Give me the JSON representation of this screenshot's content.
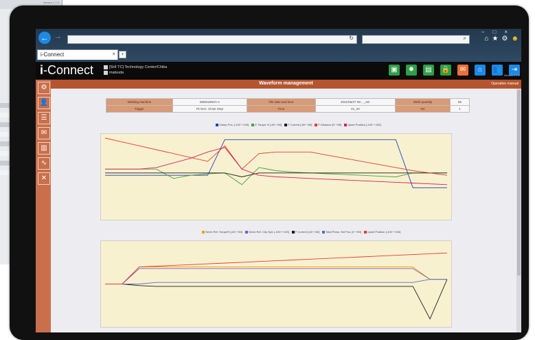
{
  "background_window": {
    "version_text": "Version 1.7.0",
    "stripe_colors": [
      "#c9cdd2",
      "#f2f3f5",
      "#c9cdd2",
      "#f2f3f5",
      "#c9cdd2",
      "#f2f3f5",
      "#c9cdd2",
      "#f2f3f5"
    ]
  },
  "browser": {
    "tab_title": "i-Connect",
    "address_value": "",
    "refresh_glyph": "↻",
    "search_glyph": "⌕",
    "window_controls": [
      "–",
      "□",
      "×"
    ],
    "nav_icons": [
      "home-icon",
      "star-icon",
      "gear-icon",
      "smiley-icon"
    ]
  },
  "app": {
    "logo_prefix": "i",
    "logo_rest": "-Connect",
    "site_name": "[SHI TC] Technology Center/Chiba",
    "user_name": "matsuda",
    "version": "Version 1.7.0",
    "header_icons": [
      {
        "name": "monitor-icon",
        "color": "#2f9e44"
      },
      {
        "name": "gear-settings-icon",
        "color": "#2f9e44"
      },
      {
        "name": "document-icon",
        "color": "#2f9e44"
      },
      {
        "name": "lock-icon",
        "color": "#2f9e44"
      },
      {
        "name": "chat-icon",
        "color": "#e8703a"
      },
      {
        "name": "home-icon",
        "color": "#1e88e5"
      },
      {
        "name": "users-icon",
        "color": "#1e88e5"
      },
      {
        "name": "logout-icon",
        "color": "#1e88e5"
      }
    ],
    "side_menu": [
      {
        "name": "welder-icon",
        "glyph": "⚙"
      },
      {
        "name": "people-icon",
        "glyph": "👤"
      },
      {
        "name": "list-icon",
        "glyph": "☰"
      },
      {
        "name": "mail-icon",
        "glyph": "✉"
      },
      {
        "name": "bar-chart-icon",
        "glyph": "▥"
      },
      {
        "name": "waveform-icon",
        "glyph": "∿"
      },
      {
        "name": "tools-icon",
        "glyph": "✕"
      }
    ]
  },
  "page": {
    "title": "Waveform management",
    "manual_link": "Operation manual",
    "info": {
      "welding_machine_label": "Welding machine",
      "welding_machine_value": "DB0015N0Y-A",
      "file_date_label": "File date and time",
      "file_date_value": "2021/06/27 05:..._NC",
      "weld_qty_label": "Weld quantity",
      "weld_qty_value": "65",
      "trigger_label": "Trigger",
      "trigger_value": "Fit Gen. Close Stop",
      "time_label": "Time",
      "time_value": "01_20",
      "ver_label": "Ver",
      "ver_value": "1"
    }
  },
  "chart_data": [
    {
      "type": "line",
      "title": "",
      "legend_placement": "top-center",
      "legend": [
        {
          "label": "Clamp Pos. [-100~+100]",
          "color": "#1c3fbf"
        },
        {
          "label": "E Torque % [-60~+60]",
          "color": "#43a047"
        },
        {
          "label": "F Current [-60~+60]",
          "color": "#1b1b1b"
        },
        {
          "label": "F Distance [0~+50]",
          "color": "#e53935"
        },
        {
          "label": "Upset Position [-100~+100]",
          "color": "#d81b60"
        }
      ],
      "x": [
        0,
        5,
        10,
        15,
        20,
        25,
        30,
        35,
        40,
        45,
        50,
        55,
        60,
        65,
        70,
        75,
        80,
        85,
        90,
        95,
        100
      ],
      "ylim": [
        0,
        100
      ],
      "grid": false,
      "series": [
        {
          "name": "Clamp Pos. [-100~+100]",
          "color": "#1c3fbf",
          "values": [
            52,
            52,
            52,
            52,
            52,
            52,
            52,
            98,
            98,
            98,
            98,
            98,
            98,
            98,
            98,
            98,
            98,
            98,
            36,
            36,
            36
          ]
        },
        {
          "name": "E Torque % [-60~+60]",
          "color": "#43a047",
          "values": [
            60,
            60,
            60,
            60,
            48,
            52,
            54,
            55,
            40,
            62,
            58,
            56,
            55,
            54,
            53,
            52,
            51,
            50,
            55,
            55,
            55
          ]
        },
        {
          "name": "F Current [-60~+60]",
          "color": "#1b1b1b",
          "values": [
            55,
            55,
            55,
            55,
            55,
            55,
            55,
            55,
            50,
            55,
            55,
            55,
            55,
            55,
            55,
            55,
            55,
            55,
            55,
            55,
            55
          ]
        },
        {
          "name": "F Distance [0~+50]",
          "color": "#e53935",
          "values": [
            100,
            95,
            90,
            85,
            80,
            75,
            70,
            90,
            60,
            80,
            82,
            82,
            82,
            78,
            74,
            70,
            66,
            62,
            58,
            55,
            52
          ]
        },
        {
          "name": "Upset Position [-100~+100]",
          "color": "#d81b60",
          "values": [
            60,
            60,
            60,
            62,
            68,
            74,
            82,
            88,
            60,
            52,
            50,
            49,
            48,
            47,
            46,
            45,
            44,
            43,
            42,
            41,
            40
          ]
        }
      ]
    },
    {
      "type": "line",
      "title": "",
      "legend_placement": "top-center",
      "legend": [
        {
          "label": "Serve Ref. Torque% [-60~+60]",
          "color": "#f39c12"
        },
        {
          "label": "Serve Ref. Clip Spd. [-100~+100]",
          "color": "#7e57c2"
        },
        {
          "label": "F Current [-60~+60]",
          "color": "#1b1b1b"
        },
        {
          "label": "Total Press. Set Pos. [0~+50]",
          "color": "#5c6bc0"
        },
        {
          "label": "Upset Position [-100~+100]",
          "color": "#e53935"
        }
      ],
      "x": [
        0,
        5,
        10,
        15,
        20,
        25,
        30,
        35,
        40,
        45,
        50,
        55,
        60,
        65,
        70,
        75,
        80,
        85,
        90,
        95,
        100
      ],
      "ylim": [
        0,
        100
      ],
      "grid": false,
      "series": [
        {
          "name": "Serve Ref. Torque% [-60~+60]",
          "color": "#f39c12",
          "values": [
            50,
            50,
            72,
            72,
            72,
            72,
            72,
            72,
            72,
            72,
            72,
            72,
            72,
            72,
            72,
            72,
            72,
            72,
            72,
            56,
            56
          ]
        },
        {
          "name": "Serve Ref. Clip Spd. [-100~+100]",
          "color": "#7e57c2",
          "values": [
            50,
            50,
            70,
            70,
            70,
            70,
            70,
            70,
            70,
            70,
            70,
            70,
            70,
            70,
            70,
            70,
            70,
            70,
            70,
            56,
            56
          ]
        },
        {
          "name": "F Current [-60~+60]",
          "color": "#1b1b1b",
          "values": [
            50,
            50,
            48,
            47,
            47,
            47,
            47,
            47,
            47,
            47,
            47,
            47,
            47,
            47,
            47,
            47,
            47,
            47,
            47,
            5,
            56
          ]
        },
        {
          "name": "Total Press. Set Pos. [0~+50]",
          "color": "#5c6bc0",
          "values": [
            50,
            50,
            50,
            52,
            52,
            52,
            52,
            52,
            52,
            52,
            52,
            52,
            52,
            52,
            52,
            52,
            52,
            52,
            52,
            56,
            56
          ]
        },
        {
          "name": "Upset Position [-100~+100]",
          "color": "#e53935",
          "values": [
            50,
            50,
            72,
            73,
            74,
            75,
            76,
            77,
            78,
            79,
            80,
            81,
            82,
            83,
            84,
            85,
            86,
            87,
            88,
            89,
            90
          ]
        }
      ]
    }
  ]
}
